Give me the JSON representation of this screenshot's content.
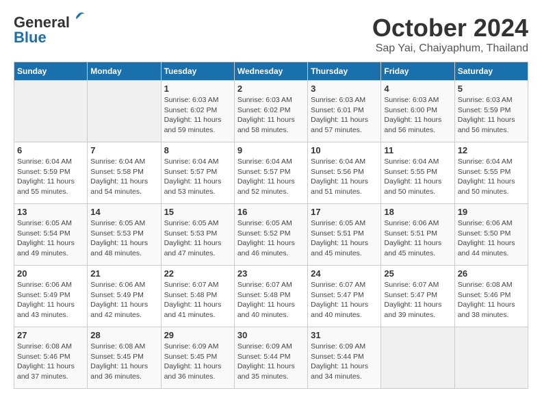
{
  "logo": {
    "line1": "General",
    "line2": "Blue"
  },
  "title": "October 2024",
  "subtitle": "Sap Yai, Chaiyaphum, Thailand",
  "days_of_week": [
    "Sunday",
    "Monday",
    "Tuesday",
    "Wednesday",
    "Thursday",
    "Friday",
    "Saturday"
  ],
  "weeks": [
    [
      {
        "day": "",
        "info": ""
      },
      {
        "day": "",
        "info": ""
      },
      {
        "day": "1",
        "info": "Sunrise: 6:03 AM\nSunset: 6:02 PM\nDaylight: 11 hours and 59 minutes."
      },
      {
        "day": "2",
        "info": "Sunrise: 6:03 AM\nSunset: 6:02 PM\nDaylight: 11 hours and 58 minutes."
      },
      {
        "day": "3",
        "info": "Sunrise: 6:03 AM\nSunset: 6:01 PM\nDaylight: 11 hours and 57 minutes."
      },
      {
        "day": "4",
        "info": "Sunrise: 6:03 AM\nSunset: 6:00 PM\nDaylight: 11 hours and 56 minutes."
      },
      {
        "day": "5",
        "info": "Sunrise: 6:03 AM\nSunset: 5:59 PM\nDaylight: 11 hours and 56 minutes."
      }
    ],
    [
      {
        "day": "6",
        "info": "Sunrise: 6:04 AM\nSunset: 5:59 PM\nDaylight: 11 hours and 55 minutes."
      },
      {
        "day": "7",
        "info": "Sunrise: 6:04 AM\nSunset: 5:58 PM\nDaylight: 11 hours and 54 minutes."
      },
      {
        "day": "8",
        "info": "Sunrise: 6:04 AM\nSunset: 5:57 PM\nDaylight: 11 hours and 53 minutes."
      },
      {
        "day": "9",
        "info": "Sunrise: 6:04 AM\nSunset: 5:57 PM\nDaylight: 11 hours and 52 minutes."
      },
      {
        "day": "10",
        "info": "Sunrise: 6:04 AM\nSunset: 5:56 PM\nDaylight: 11 hours and 51 minutes."
      },
      {
        "day": "11",
        "info": "Sunrise: 6:04 AM\nSunset: 5:55 PM\nDaylight: 11 hours and 50 minutes."
      },
      {
        "day": "12",
        "info": "Sunrise: 6:04 AM\nSunset: 5:55 PM\nDaylight: 11 hours and 50 minutes."
      }
    ],
    [
      {
        "day": "13",
        "info": "Sunrise: 6:05 AM\nSunset: 5:54 PM\nDaylight: 11 hours and 49 minutes."
      },
      {
        "day": "14",
        "info": "Sunrise: 6:05 AM\nSunset: 5:53 PM\nDaylight: 11 hours and 48 minutes."
      },
      {
        "day": "15",
        "info": "Sunrise: 6:05 AM\nSunset: 5:53 PM\nDaylight: 11 hours and 47 minutes."
      },
      {
        "day": "16",
        "info": "Sunrise: 6:05 AM\nSunset: 5:52 PM\nDaylight: 11 hours and 46 minutes."
      },
      {
        "day": "17",
        "info": "Sunrise: 6:05 AM\nSunset: 5:51 PM\nDaylight: 11 hours and 45 minutes."
      },
      {
        "day": "18",
        "info": "Sunrise: 6:06 AM\nSunset: 5:51 PM\nDaylight: 11 hours and 45 minutes."
      },
      {
        "day": "19",
        "info": "Sunrise: 6:06 AM\nSunset: 5:50 PM\nDaylight: 11 hours and 44 minutes."
      }
    ],
    [
      {
        "day": "20",
        "info": "Sunrise: 6:06 AM\nSunset: 5:49 PM\nDaylight: 11 hours and 43 minutes."
      },
      {
        "day": "21",
        "info": "Sunrise: 6:06 AM\nSunset: 5:49 PM\nDaylight: 11 hours and 42 minutes."
      },
      {
        "day": "22",
        "info": "Sunrise: 6:07 AM\nSunset: 5:48 PM\nDaylight: 11 hours and 41 minutes."
      },
      {
        "day": "23",
        "info": "Sunrise: 6:07 AM\nSunset: 5:48 PM\nDaylight: 11 hours and 40 minutes."
      },
      {
        "day": "24",
        "info": "Sunrise: 6:07 AM\nSunset: 5:47 PM\nDaylight: 11 hours and 40 minutes."
      },
      {
        "day": "25",
        "info": "Sunrise: 6:07 AM\nSunset: 5:47 PM\nDaylight: 11 hours and 39 minutes."
      },
      {
        "day": "26",
        "info": "Sunrise: 6:08 AM\nSunset: 5:46 PM\nDaylight: 11 hours and 38 minutes."
      }
    ],
    [
      {
        "day": "27",
        "info": "Sunrise: 6:08 AM\nSunset: 5:46 PM\nDaylight: 11 hours and 37 minutes."
      },
      {
        "day": "28",
        "info": "Sunrise: 6:08 AM\nSunset: 5:45 PM\nDaylight: 11 hours and 36 minutes."
      },
      {
        "day": "29",
        "info": "Sunrise: 6:09 AM\nSunset: 5:45 PM\nDaylight: 11 hours and 36 minutes."
      },
      {
        "day": "30",
        "info": "Sunrise: 6:09 AM\nSunset: 5:44 PM\nDaylight: 11 hours and 35 minutes."
      },
      {
        "day": "31",
        "info": "Sunrise: 6:09 AM\nSunset: 5:44 PM\nDaylight: 11 hours and 34 minutes."
      },
      {
        "day": "",
        "info": ""
      },
      {
        "day": "",
        "info": ""
      }
    ]
  ]
}
